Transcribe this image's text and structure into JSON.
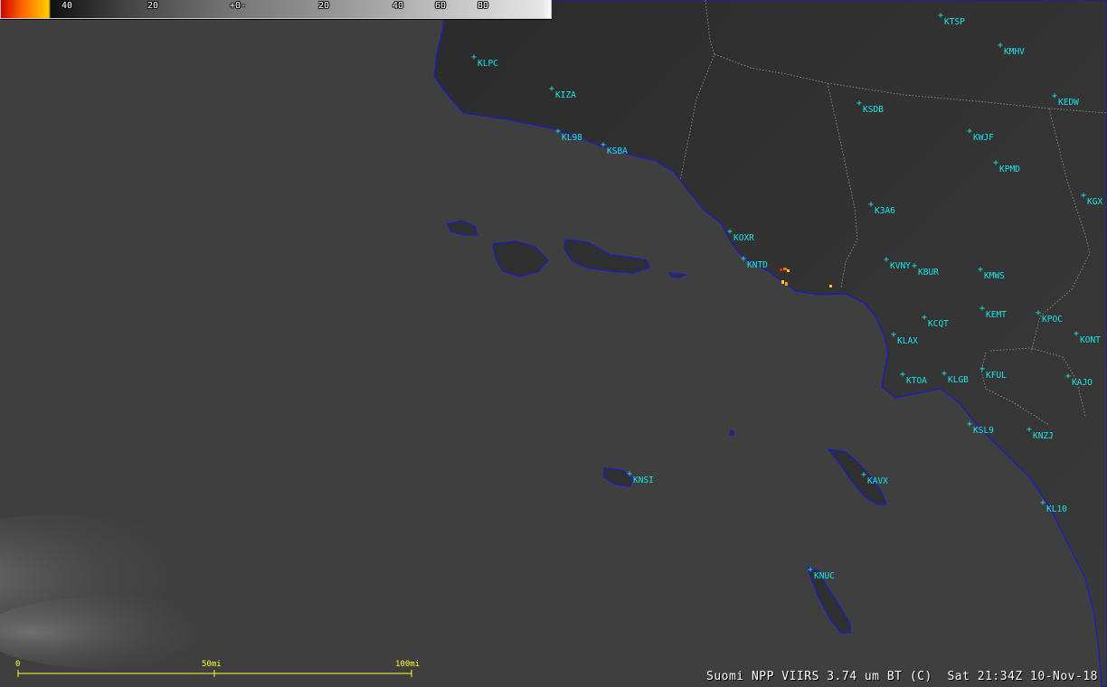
{
  "caption": "Suomi NPP VIIRS 3.74 um BT (C)  Sat 21:34Z 10-Nov-18",
  "colorbar": {
    "ticks": [
      "40",
      "20",
      "+0-",
      "20",
      "40",
      "60",
      "80"
    ]
  },
  "scalebar": {
    "labels": [
      "0",
      "50mi",
      "100mi"
    ]
  },
  "stations": [
    {
      "id": "KTSP"
    },
    {
      "id": "KMHV"
    },
    {
      "id": "KEDW"
    },
    {
      "id": "KLPC"
    },
    {
      "id": "KIZA"
    },
    {
      "id": "KSDB"
    },
    {
      "id": "KL98"
    },
    {
      "id": "KSBA"
    },
    {
      "id": "KWJF"
    },
    {
      "id": "KPMD"
    },
    {
      "id": "KGX"
    },
    {
      "id": "K3A6"
    },
    {
      "id": "KOXR"
    },
    {
      "id": "KNTD"
    },
    {
      "id": "KVNY"
    },
    {
      "id": "KBUR"
    },
    {
      "id": "KMWS"
    },
    {
      "id": "KEMT"
    },
    {
      "id": "KPOC"
    },
    {
      "id": "KCQT"
    },
    {
      "id": "KLAX"
    },
    {
      "id": "KONT"
    },
    {
      "id": "KTOA"
    },
    {
      "id": "KLGB"
    },
    {
      "id": "KFUL"
    },
    {
      "id": "KAJO"
    },
    {
      "id": "KSL9"
    },
    {
      "id": "KNZJ"
    },
    {
      "id": "KNSI"
    },
    {
      "id": "KAVX"
    },
    {
      "id": "KL10"
    },
    {
      "id": "KNUC"
    }
  ],
  "colors": {
    "ocean": "#3f3f3f",
    "land": "#2e2e2e",
    "coastline": "#1a1acc",
    "stations": "#19e6e6",
    "scalebar": "#ffff33",
    "hotspot": "#ffcc00"
  }
}
